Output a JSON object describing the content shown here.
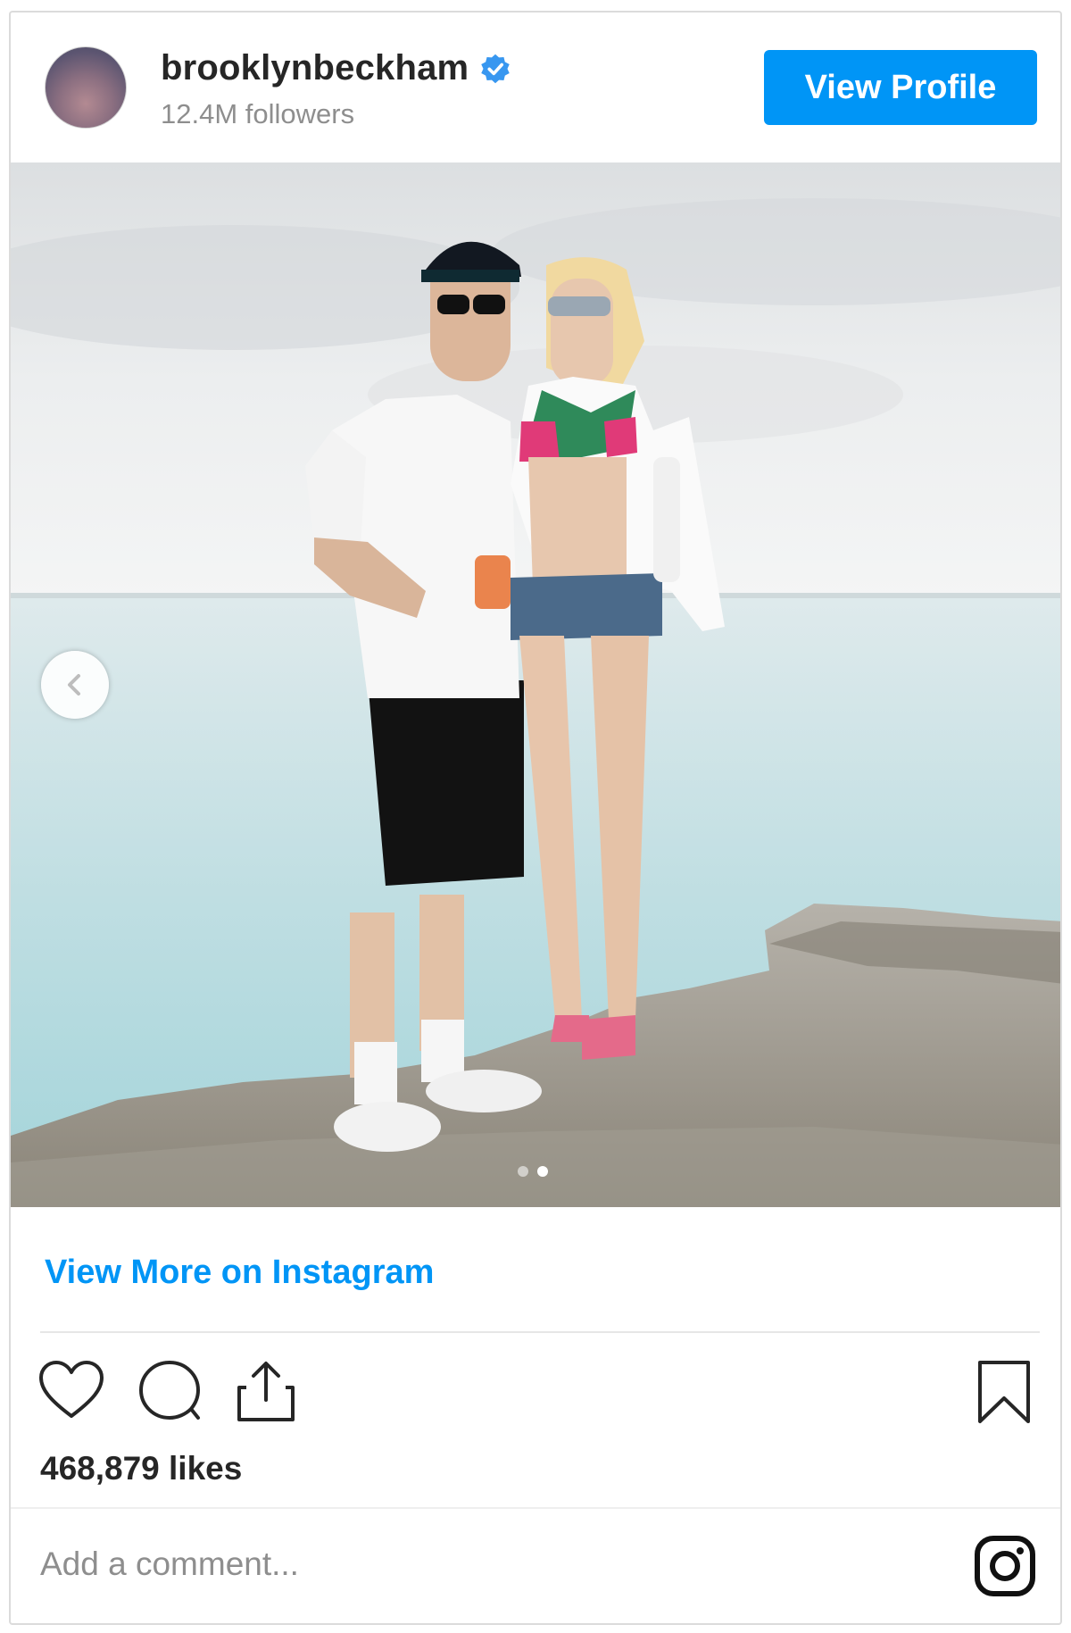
{
  "post": {
    "username": "brooklynbeckham",
    "followers": "12.4M followers",
    "view_profile_label": "View Profile",
    "view_more_label": "View More on Instagram",
    "likes": "468,879 likes",
    "comment_placeholder": "Add a comment...",
    "carousel": {
      "current_slide": 2,
      "total_slides": 2
    }
  },
  "colors": {
    "accent": "#0095f6",
    "text": "#262626",
    "muted": "#8e8e8e",
    "border": "#dbdbdb"
  },
  "icons": [
    "verified-badge-icon",
    "chevron-left-icon",
    "heart-icon",
    "comment-icon",
    "share-icon",
    "bookmark-icon",
    "instagram-logo-icon"
  ]
}
